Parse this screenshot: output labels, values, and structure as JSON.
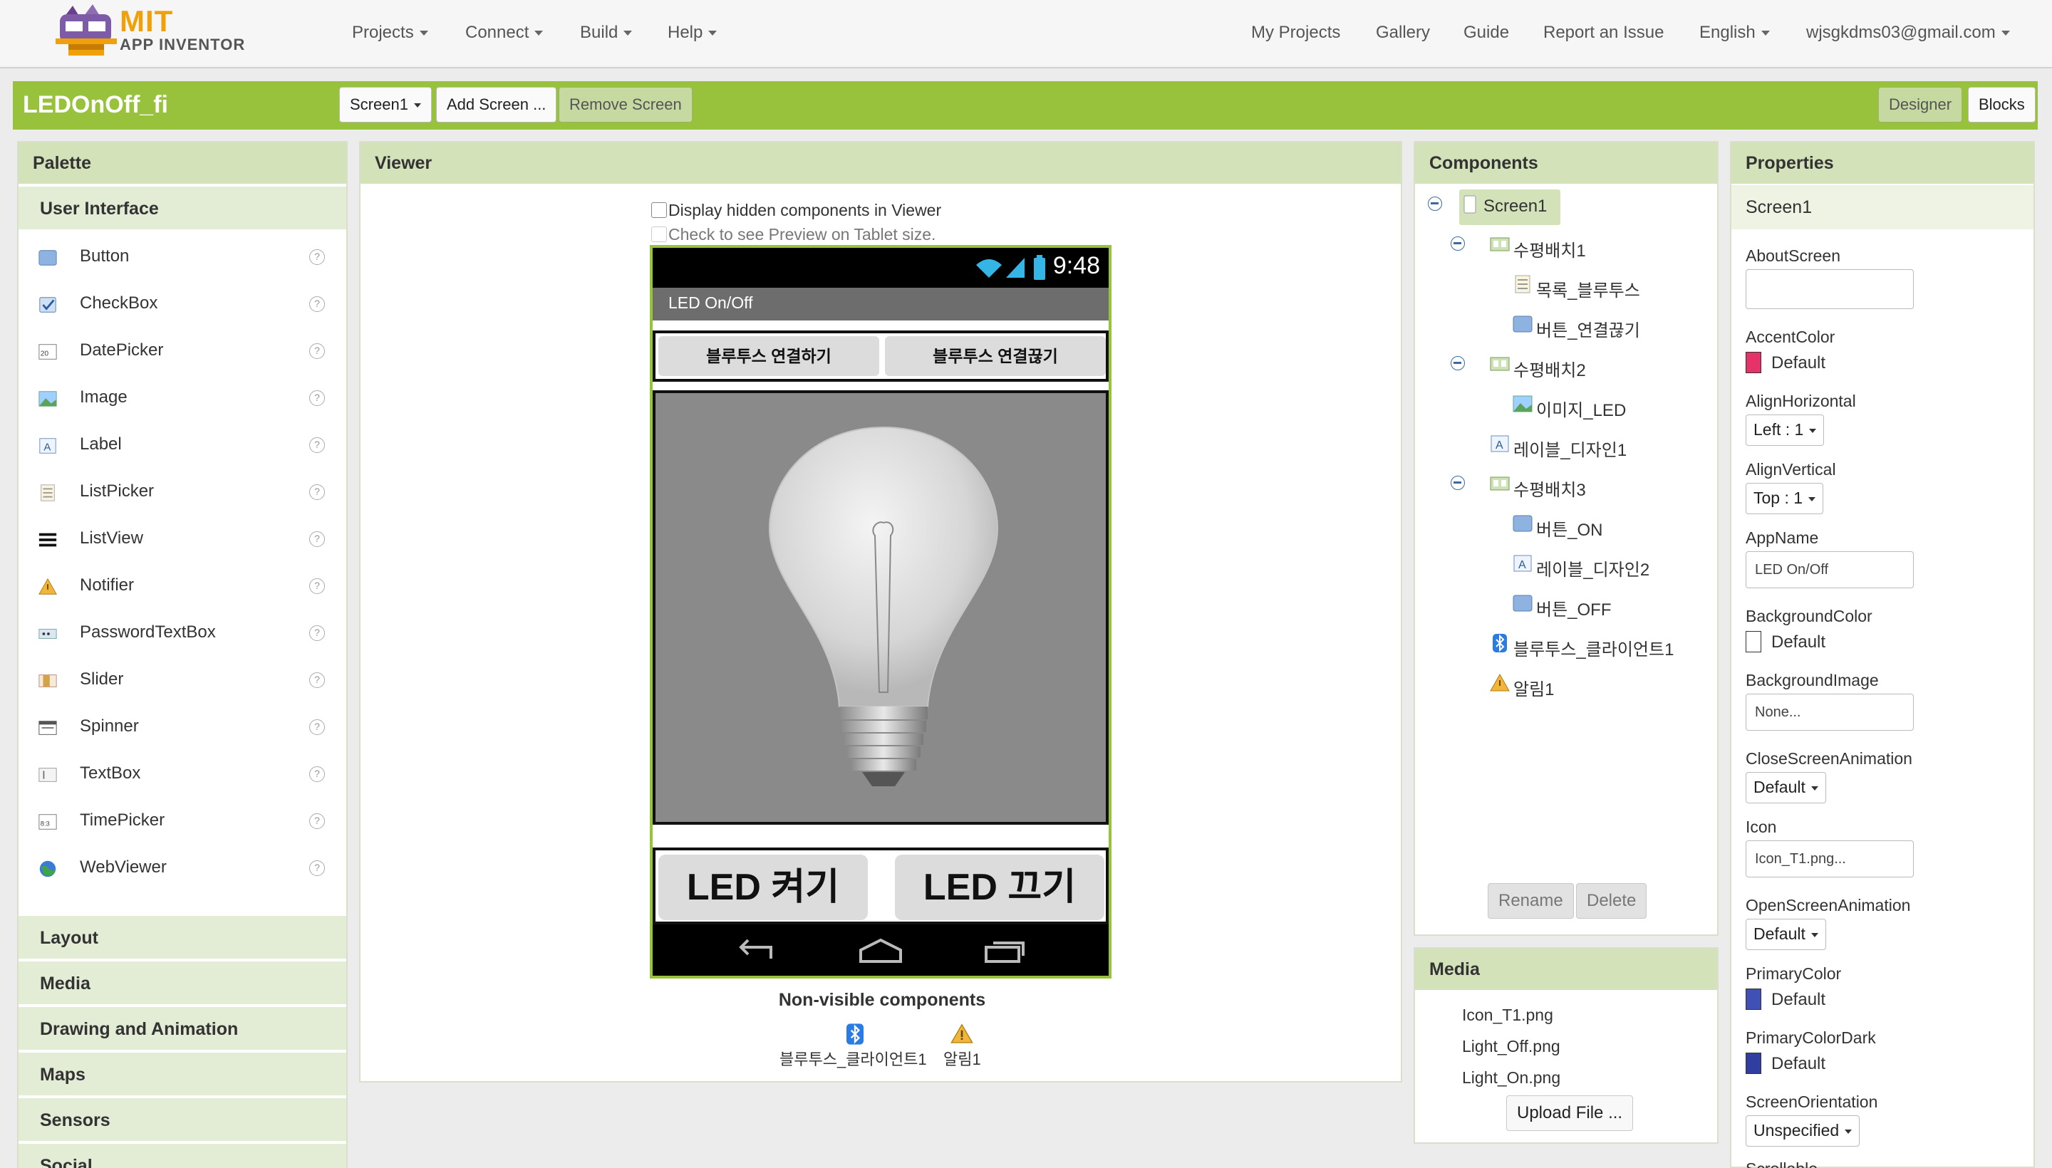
{
  "brand": {
    "mit": "MIT",
    "app_inventor": "APP INVENTOR"
  },
  "menu": {
    "projects": "Projects",
    "connect": "Connect",
    "build": "Build",
    "help": "Help",
    "my_projects": "My Projects",
    "gallery": "Gallery",
    "guide": "Guide",
    "report": "Report an Issue",
    "language": "English",
    "account": "wjsgkdms03@gmail.com"
  },
  "project": {
    "name": "LEDOnOff_fi",
    "screen_select": "Screen1",
    "add_screen": "Add Screen ...",
    "remove_screen": "Remove Screen",
    "designer": "Designer",
    "blocks": "Blocks"
  },
  "palette": {
    "title": "Palette",
    "category_open": "User Interface",
    "help_glyph": "?",
    "items": [
      {
        "label": "Button",
        "icon": "button-icon"
      },
      {
        "label": "CheckBox",
        "icon": "checkbox-icon"
      },
      {
        "label": "DatePicker",
        "icon": "datepicker-icon"
      },
      {
        "label": "Image",
        "icon": "image-icon"
      },
      {
        "label": "Label",
        "icon": "label-icon"
      },
      {
        "label": "ListPicker",
        "icon": "listpicker-icon"
      },
      {
        "label": "ListView",
        "icon": "listview-icon"
      },
      {
        "label": "Notifier",
        "icon": "notifier-icon"
      },
      {
        "label": "PasswordTextBox",
        "icon": "passwordtextbox-icon"
      },
      {
        "label": "Slider",
        "icon": "slider-icon"
      },
      {
        "label": "Spinner",
        "icon": "spinner-icon"
      },
      {
        "label": "TextBox",
        "icon": "textbox-icon"
      },
      {
        "label": "TimePicker",
        "icon": "timepicker-icon"
      },
      {
        "label": "WebViewer",
        "icon": "webviewer-icon"
      }
    ],
    "categories": [
      "Layout",
      "Media",
      "Drawing and Animation",
      "Maps",
      "Sensors",
      "Social"
    ]
  },
  "viewer": {
    "title": "Viewer",
    "hidden_checkbox": "Display hidden components in Viewer",
    "tablet_checkbox": "Check to see Preview on Tablet size.",
    "phone": {
      "time": "9:48",
      "app_title": "LED On/Off",
      "bt_connect": "블루투스 연결하기",
      "bt_disconnect": "블루투스 연결끊기",
      "led_on": "LED 켜기",
      "led_off": "LED 끄기"
    },
    "nonvisible_title": "Non-visible components",
    "nonvisible": [
      "블루투스_클라이언트1",
      "알림1"
    ]
  },
  "components": {
    "title": "Components",
    "tree": [
      "Screen1",
      "수평배치1",
      "목록_블루투스",
      "버튼_연결끊기",
      "수평배치2",
      "이미지_LED",
      "레이블_디자인1",
      "수평배치3",
      "버튼_ON",
      "레이블_디자인2",
      "버튼_OFF",
      "블루투스_클라이언트1",
      "알림1"
    ],
    "rename": "Rename",
    "delete": "Delete"
  },
  "media": {
    "title": "Media",
    "files": [
      "Icon_T1.png",
      "Light_Off.png",
      "Light_On.png"
    ],
    "upload": "Upload File ..."
  },
  "properties": {
    "title": "Properties",
    "component": "Screen1",
    "about_screen": "AboutScreen",
    "accent_color": "AccentColor",
    "accent_value": "Default",
    "align_h": "AlignHorizontal",
    "align_h_value": "Left : 1",
    "align_v": "AlignVertical",
    "align_v_value": "Top : 1",
    "app_name": "AppName",
    "app_name_value": "LED On/Off",
    "bg_color": "BackgroundColor",
    "bg_color_value": "Default",
    "bg_image": "BackgroundImage",
    "bg_image_value": "None...",
    "close_anim": "CloseScreenAnimation",
    "close_anim_value": "Default",
    "icon": "Icon",
    "icon_value": "Icon_T1.png...",
    "open_anim": "OpenScreenAnimation",
    "open_anim_value": "Default",
    "primary_color": "PrimaryColor",
    "primary_color_value": "Default",
    "primary_dark": "PrimaryColorDark",
    "primary_dark_value": "Default",
    "orientation": "ScreenOrientation",
    "orientation_value": "Unspecified",
    "scrollable": "Scrollable"
  },
  "colors": {
    "accent": "#99c23c",
    "header_bg": "#d3e2b8",
    "accent_swatch": "#e5336a",
    "primary_swatch": "#3f51b5",
    "primary_dark_swatch": "#303f9f"
  }
}
